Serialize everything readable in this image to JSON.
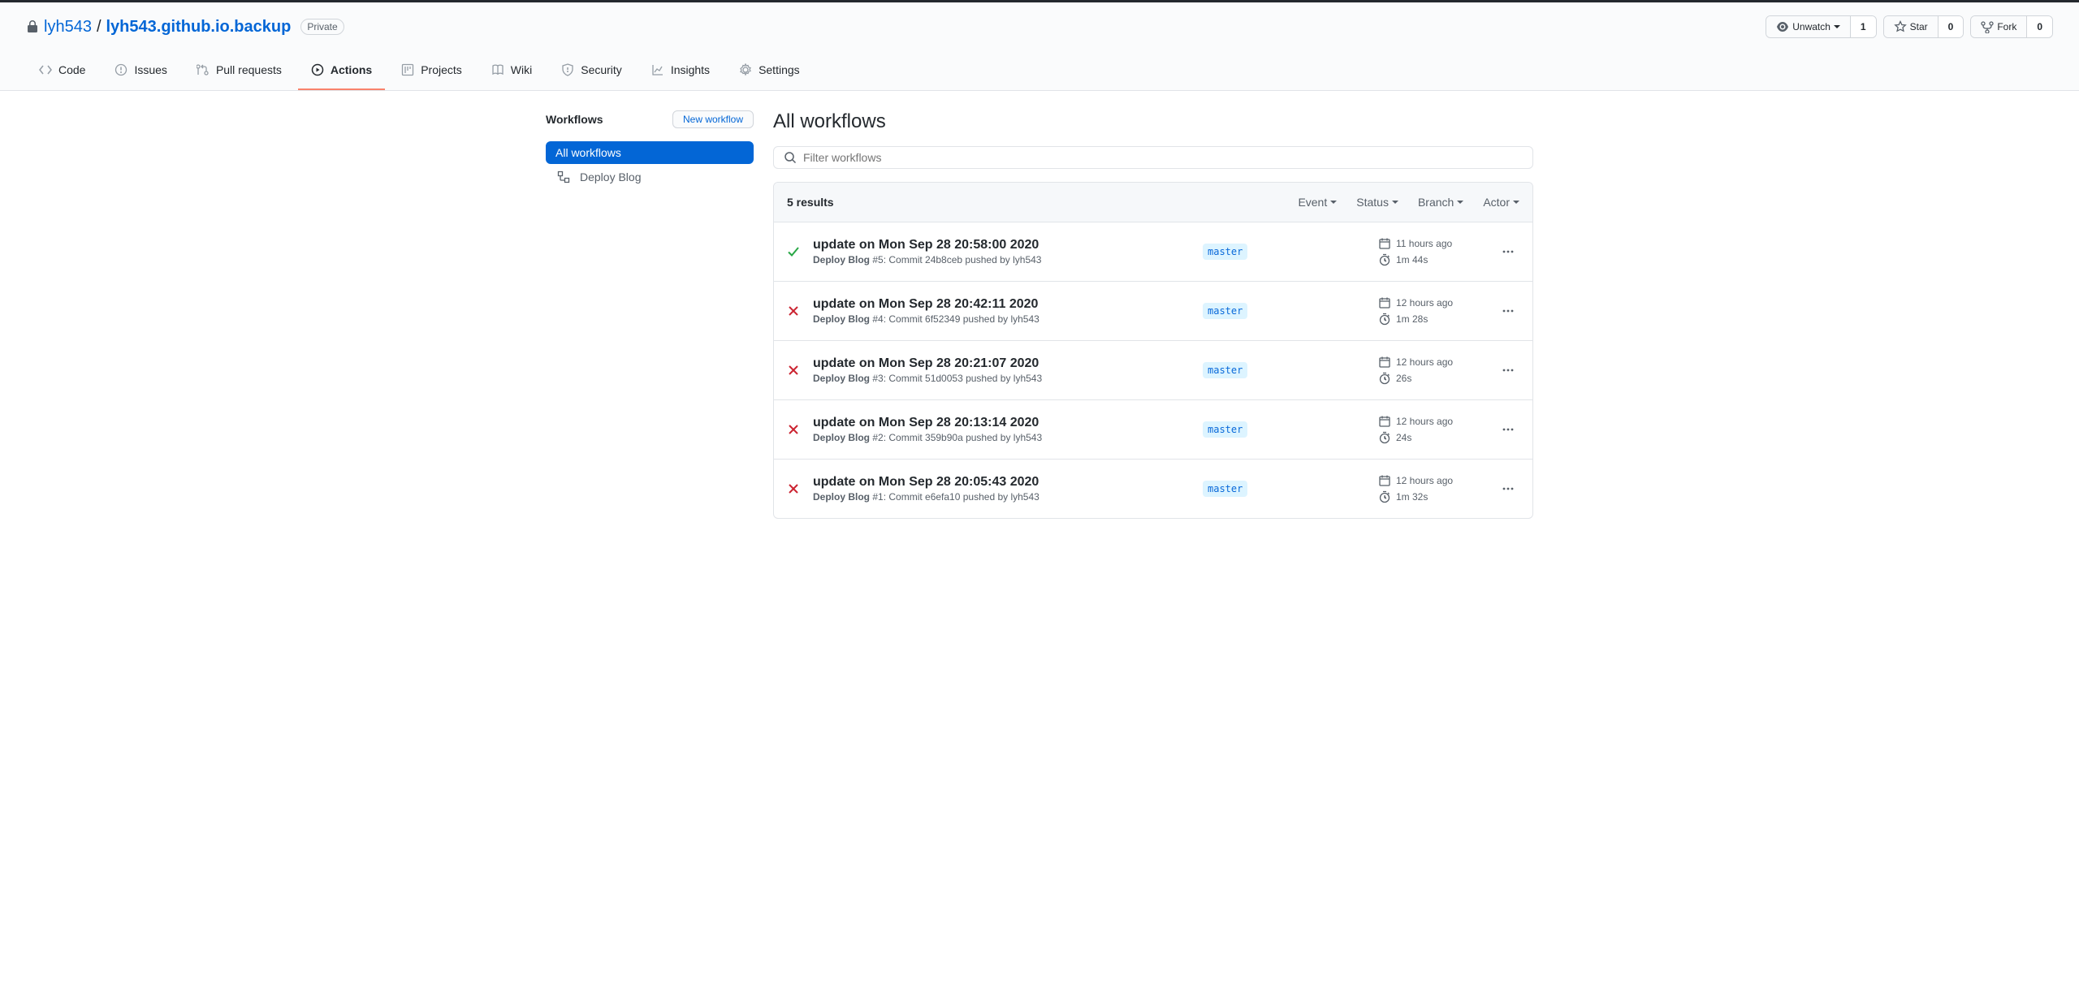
{
  "repo": {
    "owner": "lyh543",
    "name": "lyh543.github.io.backup",
    "visibility": "Private"
  },
  "actions": {
    "watch": {
      "label": "Unwatch",
      "count": "1"
    },
    "star": {
      "label": "Star",
      "count": "0"
    },
    "fork": {
      "label": "Fork",
      "count": "0"
    }
  },
  "tabs": {
    "code": "Code",
    "issues": "Issues",
    "pulls": "Pull requests",
    "actions": "Actions",
    "projects": "Projects",
    "wiki": "Wiki",
    "security": "Security",
    "insights": "Insights",
    "settings": "Settings"
  },
  "sidebar": {
    "heading": "Workflows",
    "new_btn": "New workflow",
    "all": "All workflows",
    "items": [
      {
        "label": "Deploy Blog"
      }
    ]
  },
  "page": {
    "title": "All workflows",
    "search_placeholder": "Filter workflows",
    "results": "5 results",
    "filters": {
      "event": "Event",
      "status": "Status",
      "branch": "Branch",
      "actor": "Actor"
    }
  },
  "runs": [
    {
      "status": "success",
      "title": "update on Mon Sep 28 20:58:00 2020",
      "workflow": "Deploy Blog",
      "sub": "#5: Commit 24b8ceb pushed by lyh543",
      "branch": "master",
      "when": "11 hours ago",
      "duration": "1m 44s"
    },
    {
      "status": "fail",
      "title": "update on Mon Sep 28 20:42:11 2020",
      "workflow": "Deploy Blog",
      "sub": "#4: Commit 6f52349 pushed by lyh543",
      "branch": "master",
      "when": "12 hours ago",
      "duration": "1m 28s"
    },
    {
      "status": "fail",
      "title": "update on Mon Sep 28 20:21:07 2020",
      "workflow": "Deploy Blog",
      "sub": "#3: Commit 51d0053 pushed by lyh543",
      "branch": "master",
      "when": "12 hours ago",
      "duration": "26s"
    },
    {
      "status": "fail",
      "title": "update on Mon Sep 28 20:13:14 2020",
      "workflow": "Deploy Blog",
      "sub": "#2: Commit 359b90a pushed by lyh543",
      "branch": "master",
      "when": "12 hours ago",
      "duration": "24s"
    },
    {
      "status": "fail",
      "title": "update on Mon Sep 28 20:05:43 2020",
      "workflow": "Deploy Blog",
      "sub": "#1: Commit e6efa10 pushed by lyh543",
      "branch": "master",
      "when": "12 hours ago",
      "duration": "1m 32s"
    }
  ]
}
